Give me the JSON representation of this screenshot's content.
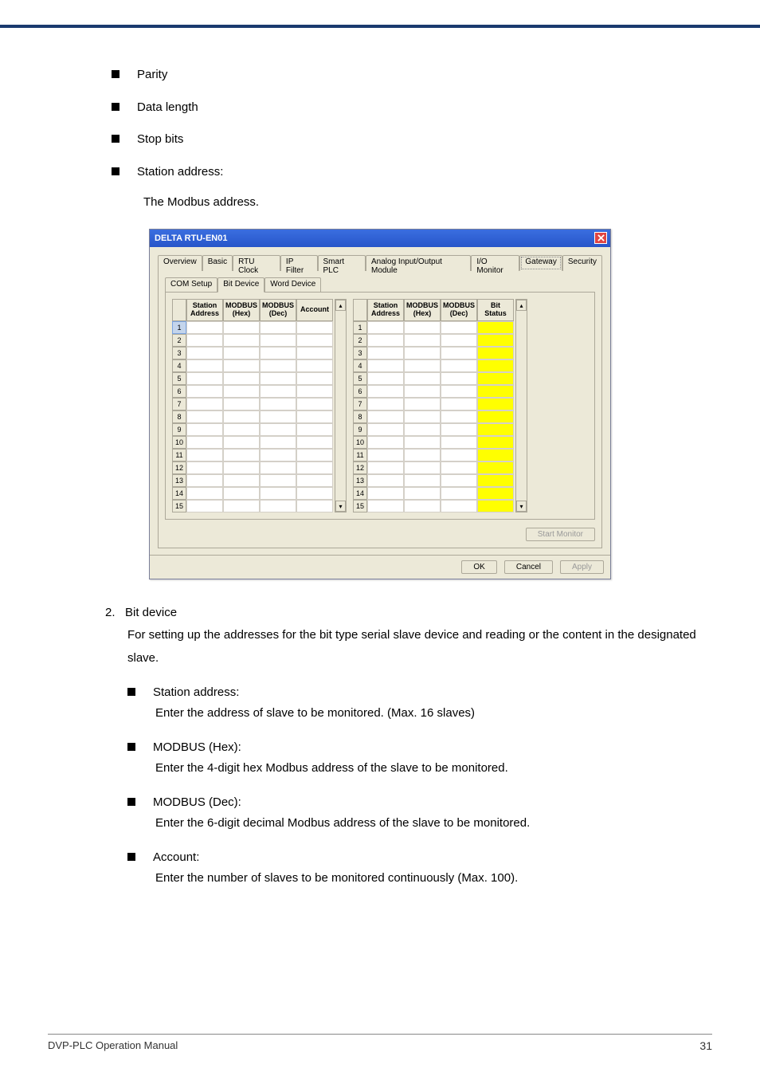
{
  "bullets_top": {
    "parity": "Parity",
    "data_length": "Data length",
    "stop_bits": "Stop bits",
    "station_address": "Station address:"
  },
  "top_desc": "The Modbus address.",
  "dialog": {
    "title": "DELTA RTU-EN01",
    "tabs": [
      "Overview",
      "Basic",
      "RTU Clock",
      "IP Filter",
      "Smart PLC",
      "Analog Input/Output Module",
      "I/O Monitor",
      "Gateway",
      "Security"
    ],
    "selected_tab": "Gateway",
    "subtabs": [
      "COM Setup",
      "Bit Device",
      "Word Device"
    ],
    "sel_subtab": "Bit Device",
    "left_headers": {
      "c1": "Station Address",
      "c2": "MODBUS (Hex)",
      "c3": "MODBUS (Dec)",
      "c4": "Account"
    },
    "right_headers": {
      "c1": "Station Address",
      "c2": "MODBUS (Hex)",
      "c3": "MODBUS (Dec)",
      "c4": "Bit Status"
    },
    "row_indices": [
      1,
      2,
      3,
      4,
      5,
      6,
      7,
      8,
      9,
      10,
      11,
      12,
      13,
      14,
      15
    ],
    "start_monitor": "Start Monitor",
    "ok": "OK",
    "cancel": "Cancel",
    "apply": "Apply"
  },
  "section2": {
    "num": "2.",
    "title": "Bit device",
    "desc": "For setting up the addresses for the bit type serial slave device and reading or the content in the designated slave.",
    "items": [
      {
        "label": "Station address:",
        "body": "Enter the address of slave to be monitored. (Max. 16 slaves)"
      },
      {
        "label": "MODBUS (Hex):",
        "body": "Enter the 4-digit hex Modbus address of the slave to be monitored."
      },
      {
        "label": "MODBUS (Dec):",
        "body": "Enter the 6-digit decimal Modbus address of the slave to be monitored."
      },
      {
        "label": "Account:",
        "body": "Enter the number of slaves to be monitored continuously (Max. 100)."
      }
    ]
  },
  "footer": {
    "left": "DVP-PLC Operation Manual",
    "right": "31"
  }
}
